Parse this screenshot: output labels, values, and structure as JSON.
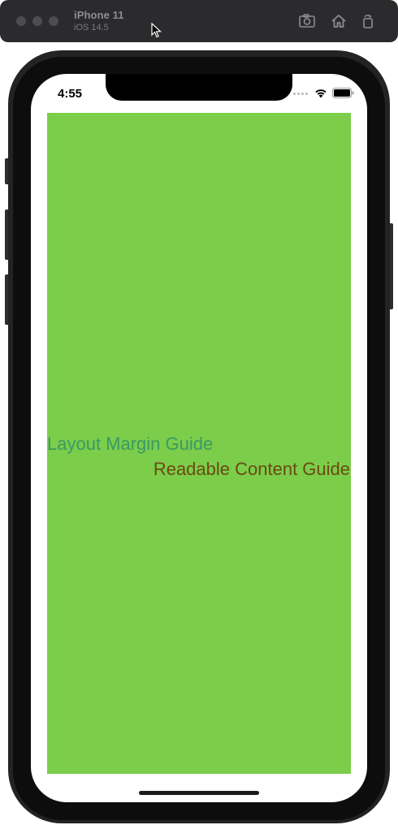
{
  "simulator": {
    "device_name": "iPhone 11",
    "os_version": "iOS 14.5",
    "buttons": {
      "screenshot": "camera-icon",
      "home": "home-icon",
      "rotate": "rotate-icon"
    }
  },
  "status_bar": {
    "time": "4:55"
  },
  "content": {
    "background_color": "#7bcd4a",
    "layout_margin_label": "Layout Margin Guide",
    "layout_margin_color": "#3a9a64",
    "readable_content_label": "Readable Content Guide",
    "readable_content_color": "#6a4a12"
  }
}
